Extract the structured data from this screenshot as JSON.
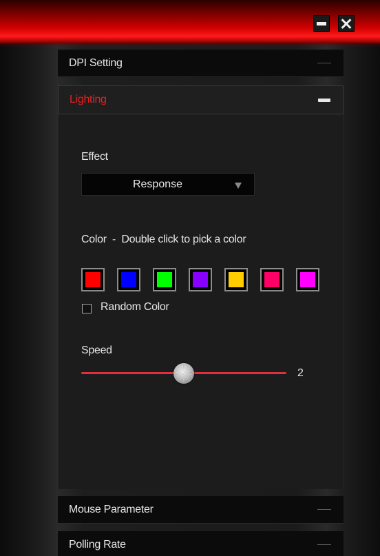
{
  "sections": {
    "dpi": {
      "label": "DPI Setting"
    },
    "lighting": {
      "label": "Lighting"
    },
    "mouse": {
      "label": "Mouse Parameter"
    },
    "polling": {
      "label": "Polling Rate"
    }
  },
  "lighting": {
    "effect_label": "Effect",
    "effect_value": "Response",
    "color_label": "Color  -  Double click to pick a color",
    "swatches": [
      "#ff0000",
      "#0000ff",
      "#00ff00",
      "#8800ff",
      "#ffcc00",
      "#ff0066",
      "#ff00ff"
    ],
    "random_color_label": "Random Color",
    "random_color_checked": false,
    "speed_label": "Speed",
    "speed_value": "2"
  },
  "colors": {
    "accent": "#e32020",
    "slider_track": "#e03040"
  },
  "icons": {
    "minimize": "minimize-icon",
    "close": "close-icon",
    "collapse": "dash-icon",
    "dropdown": "triangle-down-icon"
  }
}
